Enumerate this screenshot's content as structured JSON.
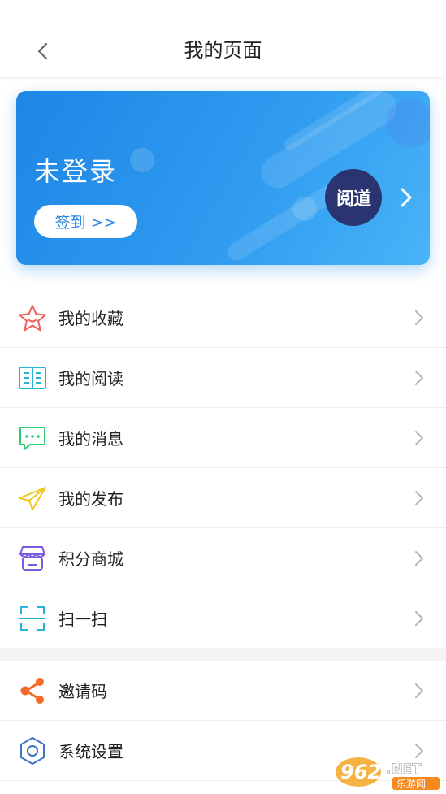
{
  "header": {
    "title": "我的页面"
  },
  "profile": {
    "status": "未登录",
    "signin_label": "签到 >>",
    "logo_text": "阅道"
  },
  "menu_group_1": [
    {
      "label": "我的收藏",
      "icon": "star-icon"
    },
    {
      "label": "我的阅读",
      "icon": "book-icon"
    },
    {
      "label": "我的消息",
      "icon": "message-icon"
    },
    {
      "label": "我的发布",
      "icon": "paper-plane-icon"
    },
    {
      "label": "积分商城",
      "icon": "store-icon"
    },
    {
      "label": "扫一扫",
      "icon": "scan-icon"
    }
  ],
  "menu_group_2": [
    {
      "label": "邀请码",
      "icon": "share-icon"
    },
    {
      "label": "系统设置",
      "icon": "settings-gear-icon"
    }
  ],
  "watermark": {
    "number": "962",
    "suffix": ".NET",
    "text": "乐游网"
  },
  "colors": {
    "card_start": "#1e86e6",
    "card_end": "#49b4f7",
    "star": "#f0605a",
    "book": "#27b3d8",
    "message": "#2ecc71",
    "plane": "#f2c618",
    "store": "#7a5ae0",
    "scan": "#27b3d8",
    "share": "#f36a2a",
    "gear": "#3d72c7"
  }
}
